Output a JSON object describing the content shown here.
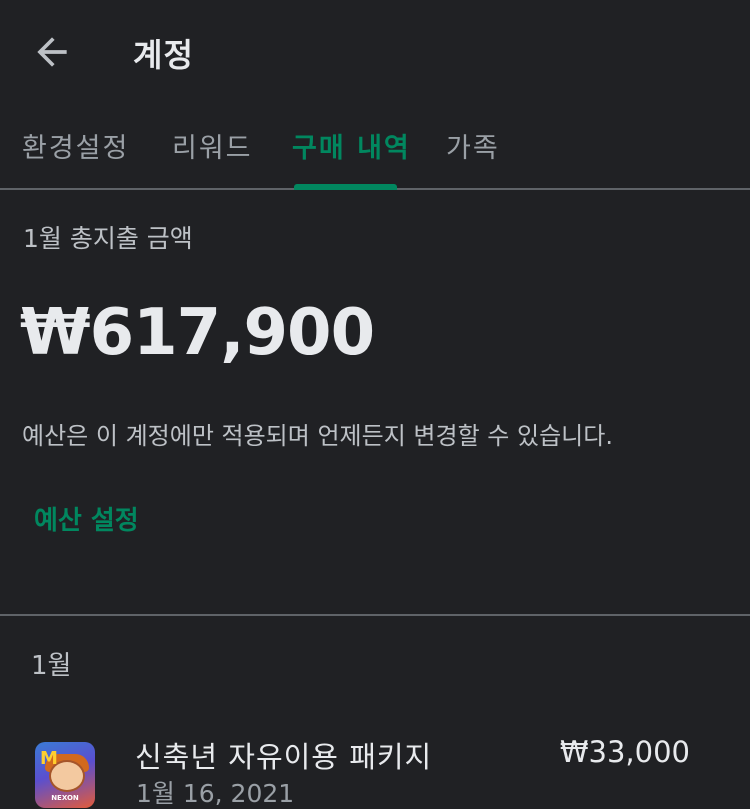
{
  "header": {
    "title": "계정",
    "back_icon": "arrow-left-icon"
  },
  "tabs": [
    {
      "label": "환경설정",
      "active": false
    },
    {
      "label": "리워드",
      "active": false
    },
    {
      "label": "구매 내역",
      "active": true
    },
    {
      "label": "가족",
      "active": false
    }
  ],
  "summary": {
    "label": "1월 총지출 금액",
    "amount": "₩617,900",
    "description": "예산은 이 계정에만 적용되며 언제든지 변경할 수 있습니다.",
    "budget_link": "예산 설정"
  },
  "month_section": {
    "label": "1월",
    "items": [
      {
        "title": "신축년 자유이용 패키지",
        "date": "1월 16, 2021",
        "price": "₩33,000",
        "icon_text": "NEXON",
        "icon_letter": "M"
      }
    ]
  },
  "colors": {
    "background": "#202124",
    "accent": "#01875f",
    "text_primary": "#e8eaed",
    "text_secondary": "#9aa0a6",
    "divider": "#5f6368"
  }
}
